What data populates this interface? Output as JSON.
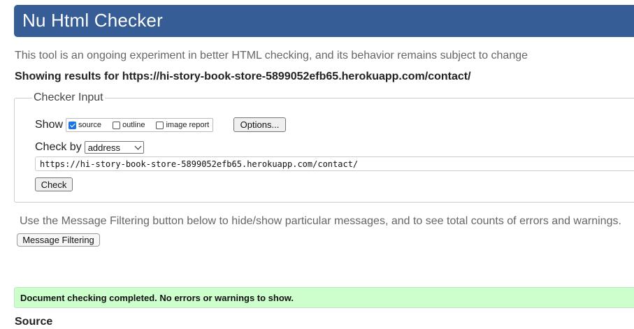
{
  "header": {
    "title": "Nu Html Checker"
  },
  "intro": "This tool is an ongoing experiment in better HTML checking, and its behavior remains subject to change",
  "results_for": "Showing results for https://hi-story-book-store-5899052efb65.herokuapp.com/contact/",
  "checker_input": {
    "legend": "Checker Input",
    "show_label": "Show",
    "show_options": [
      {
        "label": "source",
        "checked": true
      },
      {
        "label": "outline",
        "checked": false
      },
      {
        "label": "image report",
        "checked": false
      }
    ],
    "options_button": "Options...",
    "check_by_label": "Check by",
    "check_by_value": "address",
    "url_value": "https://hi-story-book-store-5899052efb65.herokuapp.com/contact/",
    "check_button": "Check"
  },
  "filtering": {
    "text": "Use the Message Filtering button below to hide/show particular messages, and to see total counts of errors and warnings.",
    "button": "Message Filtering"
  },
  "status": {
    "message": "Document checking completed. No errors or warnings to show.",
    "color": "#ccffcc"
  },
  "source_heading": "Source"
}
